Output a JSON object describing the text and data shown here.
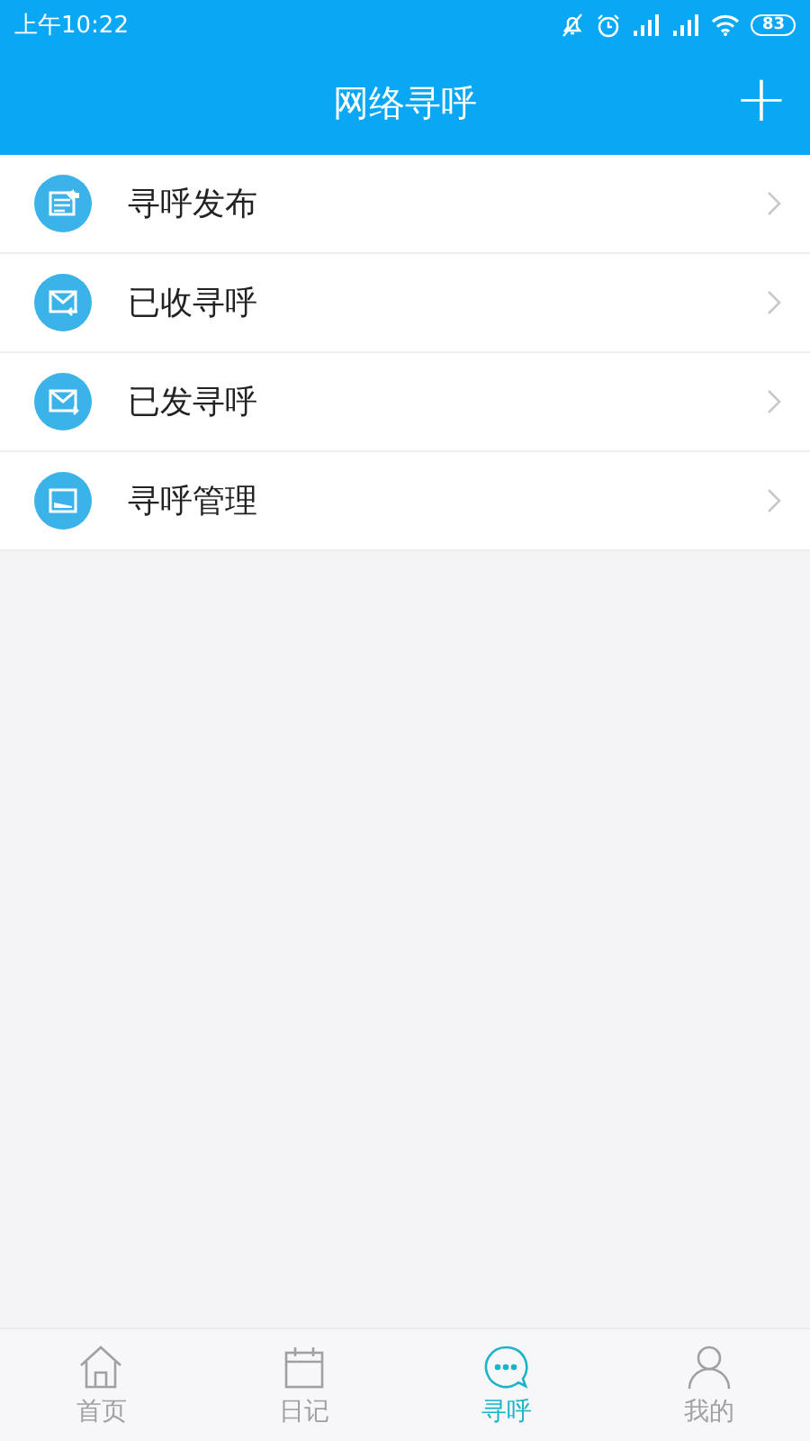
{
  "status_bar": {
    "time": "上午10:22",
    "battery": "83"
  },
  "header": {
    "title": "网络寻呼",
    "action": "+"
  },
  "menu": [
    {
      "label": "寻呼发布",
      "kind": "publish"
    },
    {
      "label": "已收寻呼",
      "kind": "inbox"
    },
    {
      "label": "已发寻呼",
      "kind": "outbox"
    },
    {
      "label": "寻呼管理",
      "kind": "manage"
    }
  ],
  "tabs": [
    {
      "label": "首页",
      "kind": "home",
      "selected": false
    },
    {
      "label": "日记",
      "kind": "diary",
      "selected": false
    },
    {
      "label": "寻呼",
      "kind": "chat",
      "selected": true
    },
    {
      "label": "我的",
      "kind": "me",
      "selected": false
    }
  ]
}
